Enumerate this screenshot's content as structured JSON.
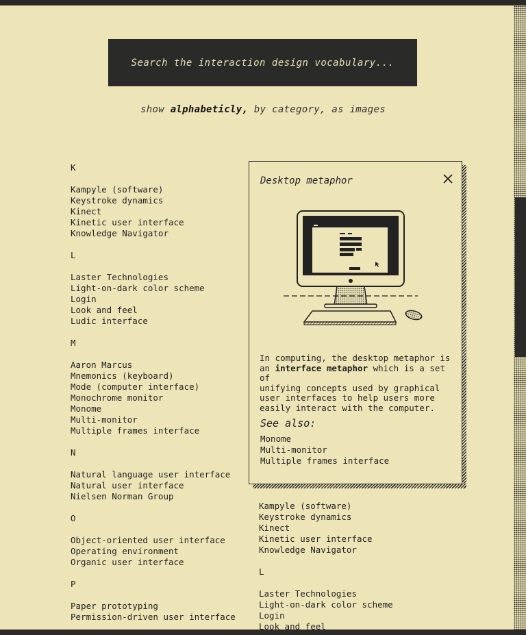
{
  "search": {
    "placeholder": "Search the interaction design vocabulary..."
  },
  "views": {
    "prefix": "show",
    "active": "alphabeticly,",
    "rest": "by category, as images"
  },
  "left_index": [
    {
      "letter": "K",
      "items": [
        "Kampyle (software)",
        "Keystroke dynamics",
        "Kinect",
        "Kinetic user interface",
        "Knowledge Navigator"
      ]
    },
    {
      "letter": "L",
      "items": [
        "Laster Technologies",
        "Light-on-dark color scheme",
        "Login",
        "Look and feel",
        "Ludic interface"
      ]
    },
    {
      "letter": "M",
      "items": [
        "Aaron Marcus",
        "Mnemonics (keyboard)",
        "Mode (computer interface)",
        "Monochrome monitor",
        "Monome",
        "Multi-monitor",
        "Multiple frames interface"
      ]
    },
    {
      "letter": "N",
      "items": [
        "Natural language user interface",
        "Natural user interface",
        "Nielsen Norman Group"
      ]
    },
    {
      "letter": "O",
      "items": [
        "Object-oriented user interface",
        "Operating environment",
        "Organic user interface"
      ]
    },
    {
      "letter": "P",
      "items": [
        "Paper prototyping",
        "Permission-driven user interface"
      ]
    }
  ],
  "right_index": {
    "k_items": [
      "Kampyle (software)",
      "Keystroke dynamics",
      "Kinect",
      "Kinetic user interface",
      "Knowledge Navigator"
    ],
    "letter_l": "L",
    "l_items": [
      "Laster Technologies",
      "Light-on-dark color scheme",
      "Login",
      "Look and feel"
    ]
  },
  "popup": {
    "title": "Desktop metaphor",
    "illustration": "desktop-computer-illustration",
    "desc_before": "In computing, the desktop metaphor is\nan ",
    "desc_bold": "interface metaphor",
    "desc_after": " which is a set of\nunifying concepts used by graphical\nuser interfaces to help users more\neasily interact with the computer.",
    "see_also_heading": "See also:",
    "see_also": [
      "Monome",
      "Multi-monitor",
      "Multiple frames interface"
    ]
  },
  "colors": {
    "background": "#ede5b8",
    "ink": "#2a2a28",
    "search_text": "#e8e1b8"
  }
}
